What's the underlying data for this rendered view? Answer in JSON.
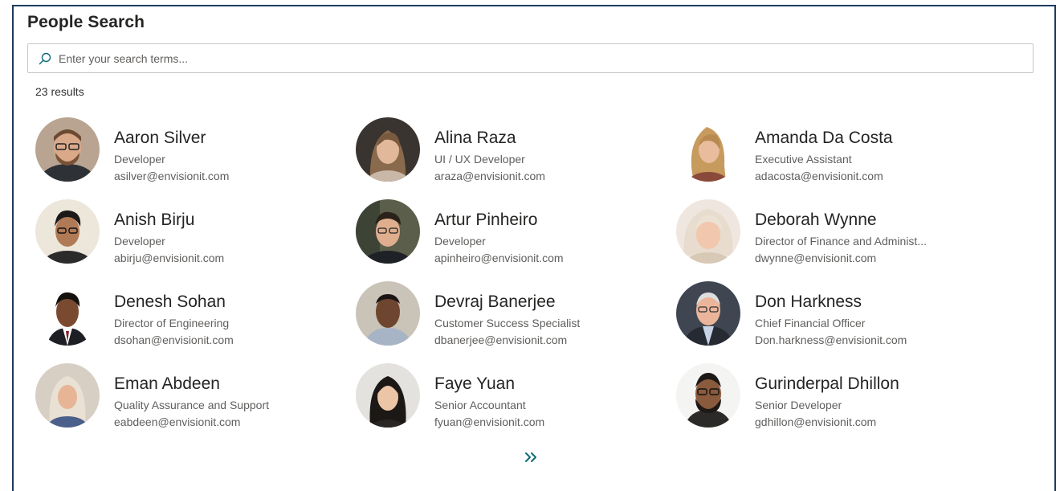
{
  "header": {
    "title": "People Search"
  },
  "search": {
    "placeholder": "Enter your search terms...",
    "value": ""
  },
  "results": {
    "count_label": "23 results"
  },
  "people": [
    {
      "name": "Aaron Silver",
      "title": "Developer",
      "email": "asilver@envisionit.com"
    },
    {
      "name": "Alina Raza",
      "title": "UI / UX Developer",
      "email": "araza@envisionit.com"
    },
    {
      "name": "Amanda Da Costa",
      "title": "Executive Assistant",
      "email": "adacosta@envisionit.com"
    },
    {
      "name": "Anish Birju",
      "title": "Developer",
      "email": "abirju@envisionit.com"
    },
    {
      "name": "Artur Pinheiro",
      "title": "Developer",
      "email": "apinheiro@envisionit.com"
    },
    {
      "name": "Deborah Wynne",
      "title": "Director of Finance and Administ...",
      "email": "dwynne@envisionit.com"
    },
    {
      "name": "Denesh Sohan",
      "title": "Director of Engineering",
      "email": "dsohan@envisionit.com"
    },
    {
      "name": "Devraj Banerjee",
      "title": "Customer Success Specialist",
      "email": "dbanerjee@envisionit.com"
    },
    {
      "name": "Don Harkness",
      "title": "Chief Financial Officer",
      "email": "Don.harkness@envisionit.com"
    },
    {
      "name": "Eman Abdeen",
      "title": "Quality Assurance and Support",
      "email": "eabdeen@envisionit.com"
    },
    {
      "name": "Faye Yuan",
      "title": "Senior Accountant",
      "email": "fyuan@envisionit.com"
    },
    {
      "name": "Gurinderpal Dhillon",
      "title": "Senior Developer",
      "email": "gdhillon@envisionit.com"
    }
  ],
  "pager": {
    "next_icon": "double-chevron-right-icon"
  },
  "colors": {
    "accent": "#0f6b78",
    "frame_border": "#1f3b5c",
    "text_primary": "#252423",
    "text_secondary": "#605e5c"
  }
}
